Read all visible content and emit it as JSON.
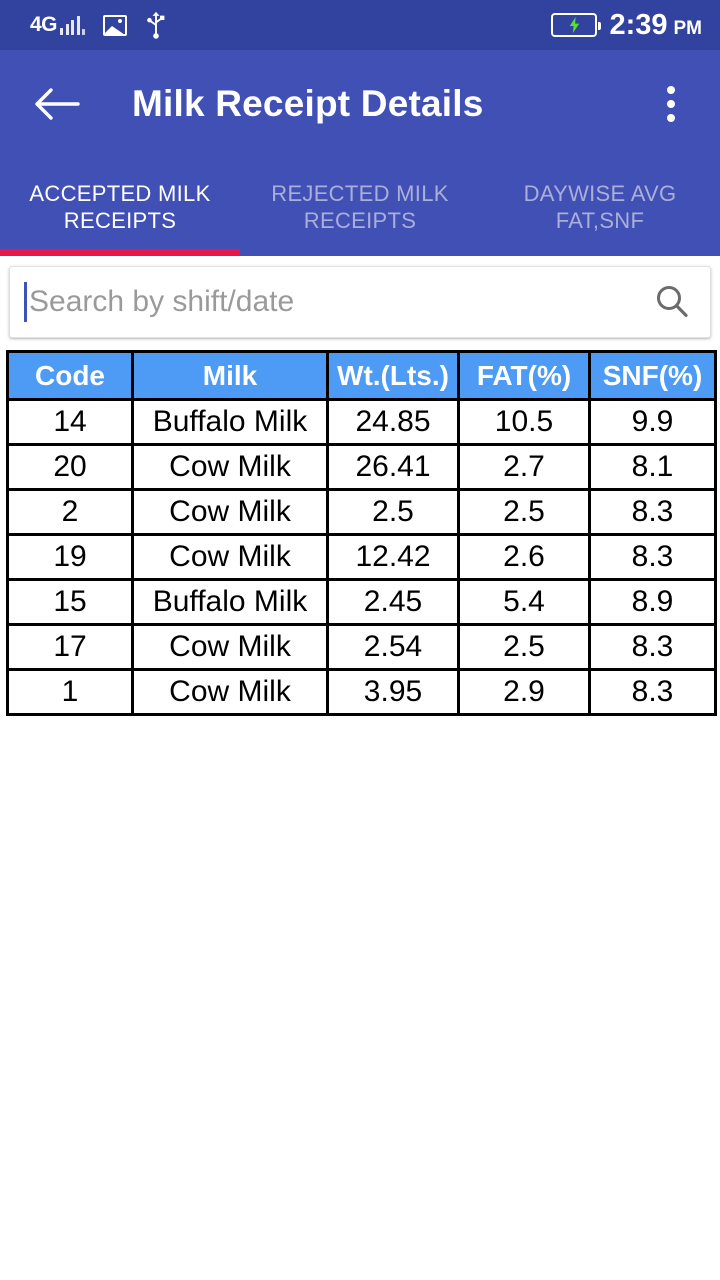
{
  "status_bar": {
    "network_type": "4G",
    "signal_icon": "signal-bars-icon",
    "photo_icon": "photo-icon",
    "usb_icon": "usb-icon",
    "battery_icon": "battery-charging-icon",
    "time": "2:39",
    "am_pm": "PM"
  },
  "app_bar": {
    "back_icon": "back-arrow-icon",
    "title": "Milk Receipt Details",
    "overflow_icon": "more-vert-icon"
  },
  "tabs": [
    {
      "label": "ACCEPTED MILK RECEIPTS",
      "active": true
    },
    {
      "label": "REJECTED MILK RECEIPTS",
      "active": false
    },
    {
      "label": "DAYWISE AVG FAT,SNF",
      "active": false
    }
  ],
  "search": {
    "value": "",
    "placeholder": "Search by shift/date",
    "icon": "search-icon"
  },
  "table": {
    "headers": [
      "Code",
      "Milk",
      "Wt.(Lts.)",
      "FAT(%)",
      "SNF(%)"
    ],
    "rows": [
      {
        "code": "14",
        "milk": "Buffalo Milk",
        "wt": "24.85",
        "fat": "10.5",
        "snf": "9.9"
      },
      {
        "code": "20",
        "milk": "Cow Milk",
        "wt": "26.41",
        "fat": "2.7",
        "snf": "8.1"
      },
      {
        "code": "2",
        "milk": "Cow Milk",
        "wt": "2.5",
        "fat": "2.5",
        "snf": "8.3"
      },
      {
        "code": "19",
        "milk": "Cow Milk",
        "wt": "12.42",
        "fat": "2.6",
        "snf": "8.3"
      },
      {
        "code": "15",
        "milk": "Buffalo Milk",
        "wt": "2.45",
        "fat": "5.4",
        "snf": "8.9"
      },
      {
        "code": "17",
        "milk": "Cow Milk",
        "wt": "2.54",
        "fat": "2.5",
        "snf": "8.3"
      },
      {
        "code": "1",
        "milk": "Cow Milk",
        "wt": "3.95",
        "fat": "2.9",
        "snf": "8.3"
      }
    ]
  },
  "colors": {
    "status_bar": "#32439f",
    "app_bar": "#4150b5",
    "tab_indicator": "#e8174a",
    "table_header": "#4d9bf5",
    "inactive_tab_text": "#a9afd8",
    "caret": "#3f51b5"
  }
}
